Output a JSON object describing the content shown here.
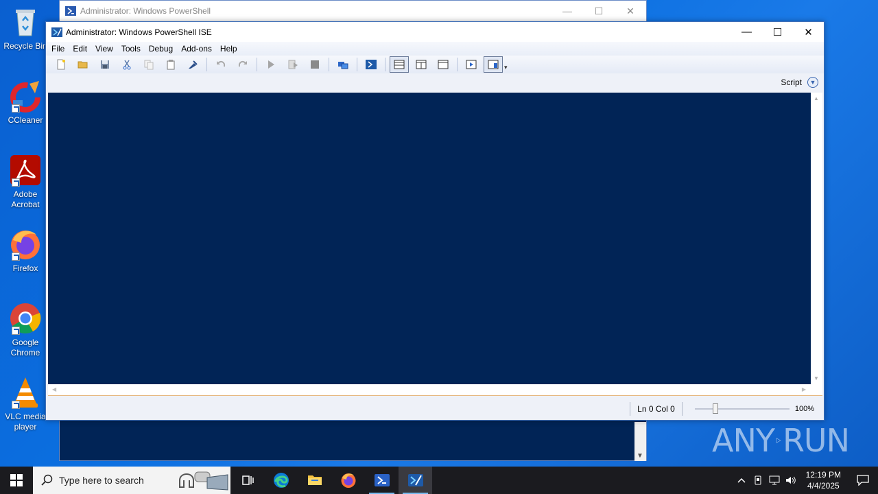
{
  "desktop": {
    "icons": [
      {
        "label": "Recycle Bin"
      },
      {
        "label": "CCleaner"
      },
      {
        "label": "Adobe Acrobat"
      },
      {
        "label": "Firefox"
      },
      {
        "label": "Google Chrome"
      },
      {
        "label": "VLC media player"
      }
    ]
  },
  "background_window": {
    "title": "Administrator: Windows PowerShell"
  },
  "ise": {
    "title": "Administrator: Windows PowerShell ISE",
    "menu": [
      "File",
      "Edit",
      "View",
      "Tools",
      "Debug",
      "Add-ons",
      "Help"
    ],
    "toolbar_icons": [
      "new-icon",
      "open-icon",
      "save-icon",
      "cut-icon",
      "copy-icon",
      "paste-icon",
      "clear-icon",
      "undo-icon",
      "redo-icon",
      "run-icon",
      "run-selection-icon",
      "stop-icon",
      "remote-icon",
      "powershell-icon",
      "layout-top-icon",
      "layout-right-icon",
      "layout-max-icon",
      "show-script-icon",
      "show-command-icon"
    ],
    "script_label": "Script",
    "status": {
      "line": "Ln 0",
      "col": "Col 0",
      "zoom": "100%",
      "zoom_fraction": 0.2
    },
    "console_color": "#012456"
  },
  "watermark": {
    "left": "ANY",
    "right": "RUN"
  },
  "taskbar": {
    "search_placeholder": "Type here to search",
    "clock_time": "12:19 PM",
    "clock_date": "4/4/2025"
  }
}
